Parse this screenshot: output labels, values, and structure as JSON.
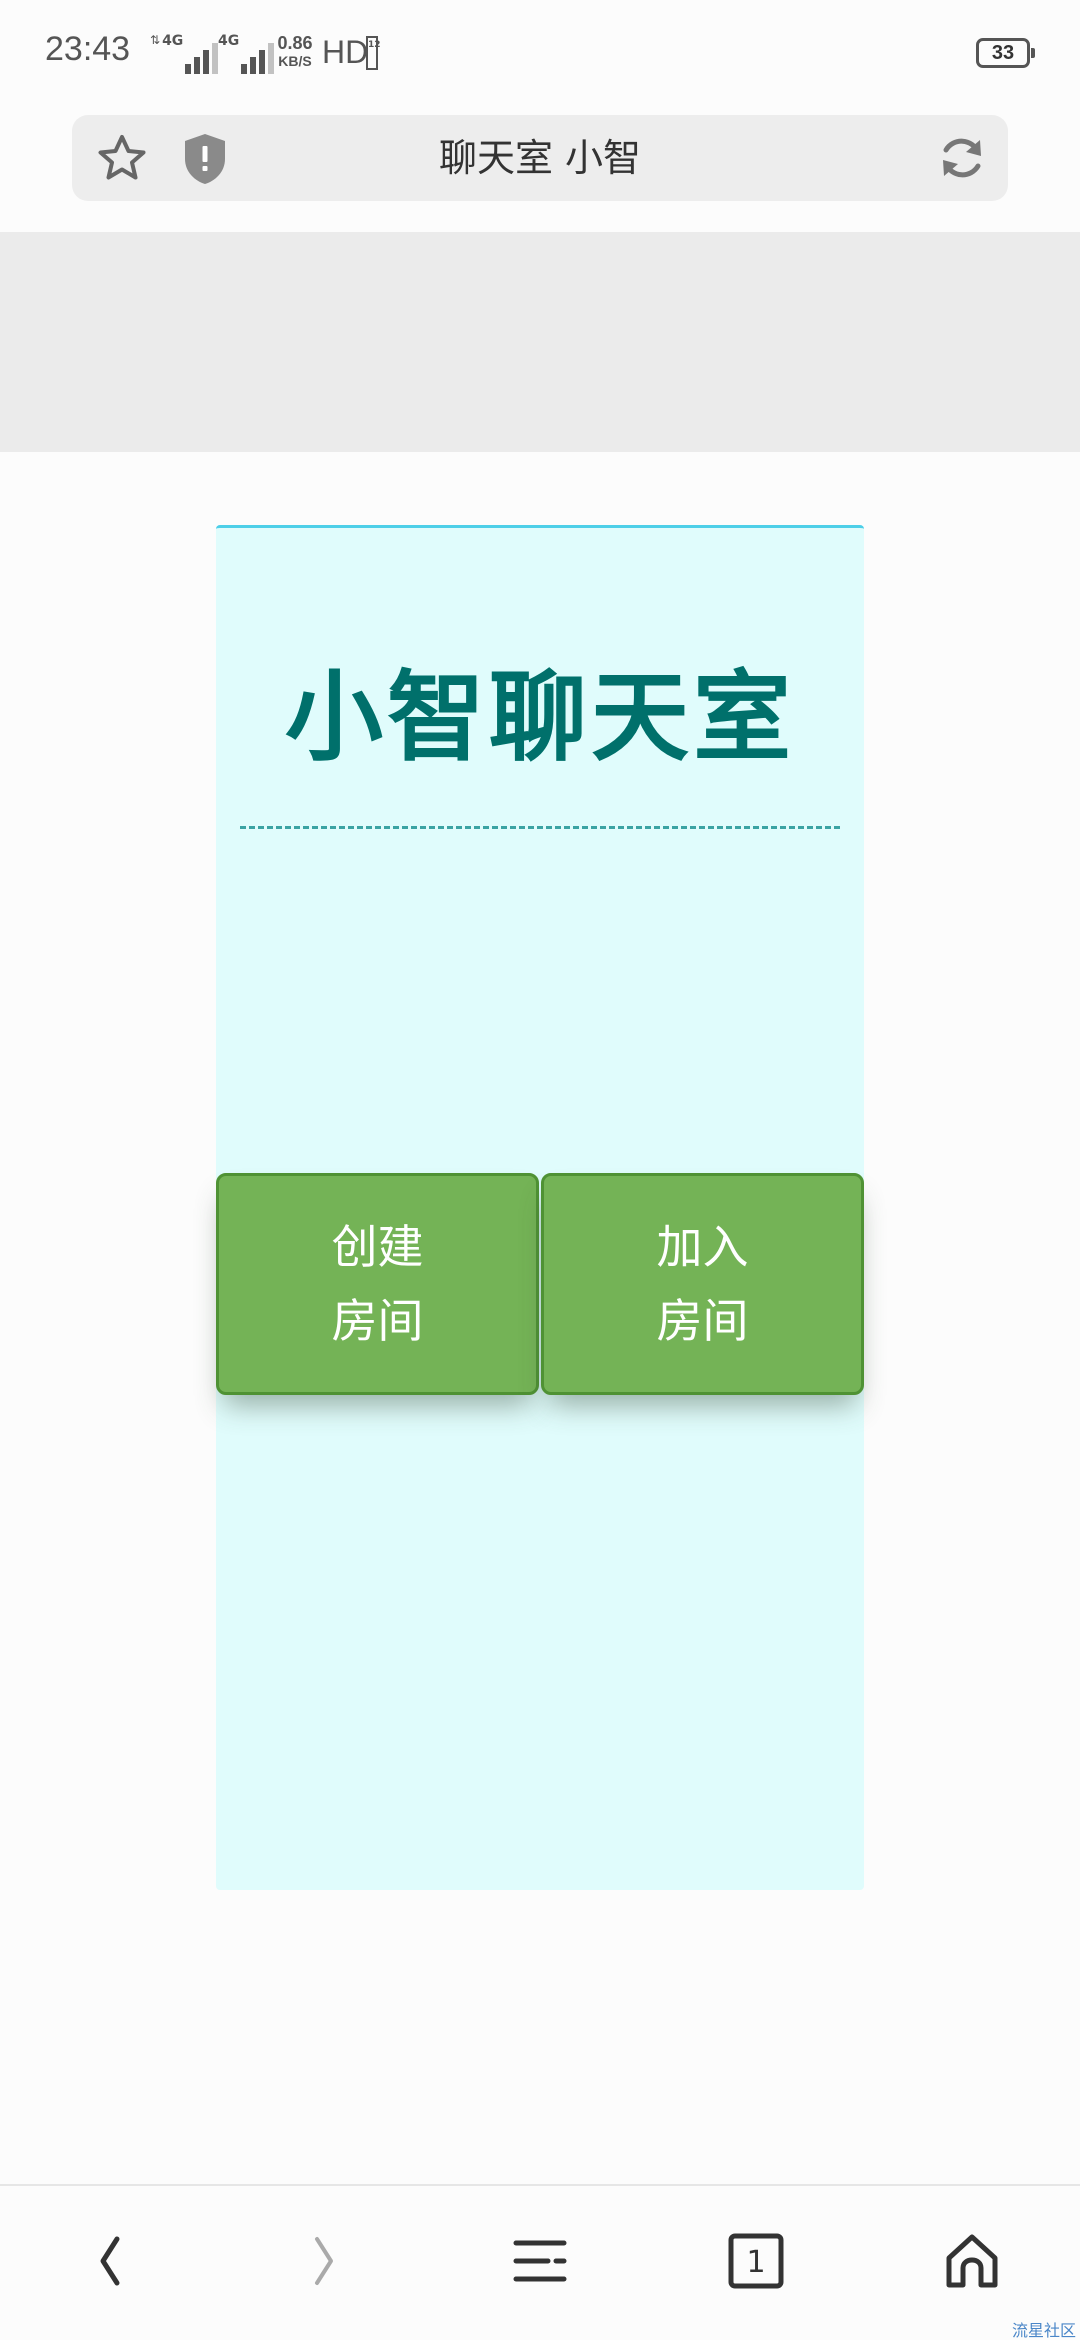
{
  "status_bar": {
    "time": "23:43",
    "network1": "4G",
    "network2": "4G",
    "speed_value": "0.86",
    "speed_unit": "KB/S",
    "hd": "HD",
    "hd_sub": "12",
    "battery": "33"
  },
  "address_bar": {
    "title": "聊天室 小智",
    "icons": [
      "star-icon",
      "shield-warning-icon",
      "reload-icon"
    ]
  },
  "card": {
    "title": "小智聊天室",
    "create_button": "创建房间",
    "join_button": "加入房间"
  },
  "bottom_nav": {
    "tabs_count": "1",
    "icons": [
      "back-icon",
      "forward-icon",
      "menu-icon",
      "tabs-icon",
      "home-icon"
    ]
  },
  "watermark": "流星社区",
  "colors": {
    "card_background": "#e0fcfc",
    "card_top_border": "#4dcfe8",
    "title_color": "#00706b",
    "button_green": "#74b356",
    "button_border": "#4f9234",
    "banner_grey": "#ebebeb"
  }
}
